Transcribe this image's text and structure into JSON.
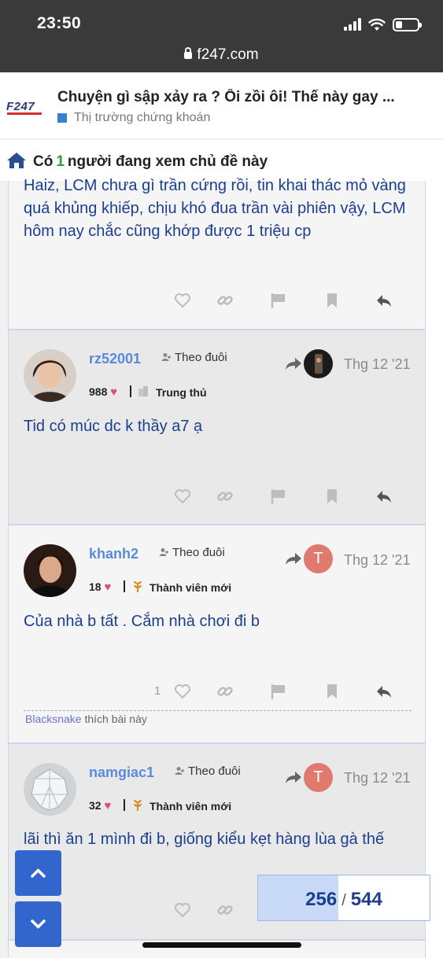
{
  "status_bar": {
    "time": "23:50"
  },
  "browser": {
    "url": "f247.com"
  },
  "site": {
    "logo": "F247"
  },
  "topic": {
    "title": "Chuyện gì sập xảy ra ? Ối zồi ôi! Thế này gay ...",
    "category": "Thị trường chứng khoán"
  },
  "viewers": {
    "prefix": "Có",
    "count": "1",
    "suffix": "người đang xem chủ đề này"
  },
  "posts": [
    {
      "text": "Haiz, LCM chưa gì trần cứng rồi, tin khai thác mỏ vàng quá khủng khiếp, chịu khó đua trần vài phiên vậy, LCM hôm nay chắc cũng khớp được 1 triệu cp"
    },
    {
      "username": "rz52001",
      "follow_label": "Theo đuôi",
      "likes_received": "988",
      "rank": "Trung thủ",
      "date": "Thg 12 '21",
      "text": "Tid có múc dc k thầy a7 ạ"
    },
    {
      "username": "khanh2",
      "follow_label": "Theo đuôi",
      "likes_received": "18",
      "rank": "Thành viên mới",
      "reply_to_initial": "T",
      "date": "Thg 12 '21",
      "text": "Của nhà b tất . Cắm nhà chơi đi b",
      "like_count": "1",
      "liked_by_user": "Blacksnake",
      "liked_by_text": "thích bài này"
    },
    {
      "username": "namgiac1",
      "follow_label": "Theo đuôi",
      "likes_received": "32",
      "rank": "Thành viên mới",
      "reply_to_initial": "T",
      "date": "Thg 12 '21",
      "text": "lãi thì ăn 1 mình đi b, giống kiểu kẹt hàng lùa gà thế"
    }
  ],
  "progress": {
    "current": "256",
    "total": "544",
    "fraction": 0.47
  },
  "icons": {
    "home": "home-icon",
    "like": "heart-icon",
    "link": "link-icon",
    "flag": "flag-icon",
    "bookmark": "bookmark-icon",
    "reply": "reply-icon",
    "up": "chevron-up-icon",
    "down": "chevron-down-icon"
  },
  "colors": {
    "accent": "#3366cc",
    "post_text": "#1c3e8f",
    "username": "#5a8ad8",
    "heart": "#e0506a"
  }
}
